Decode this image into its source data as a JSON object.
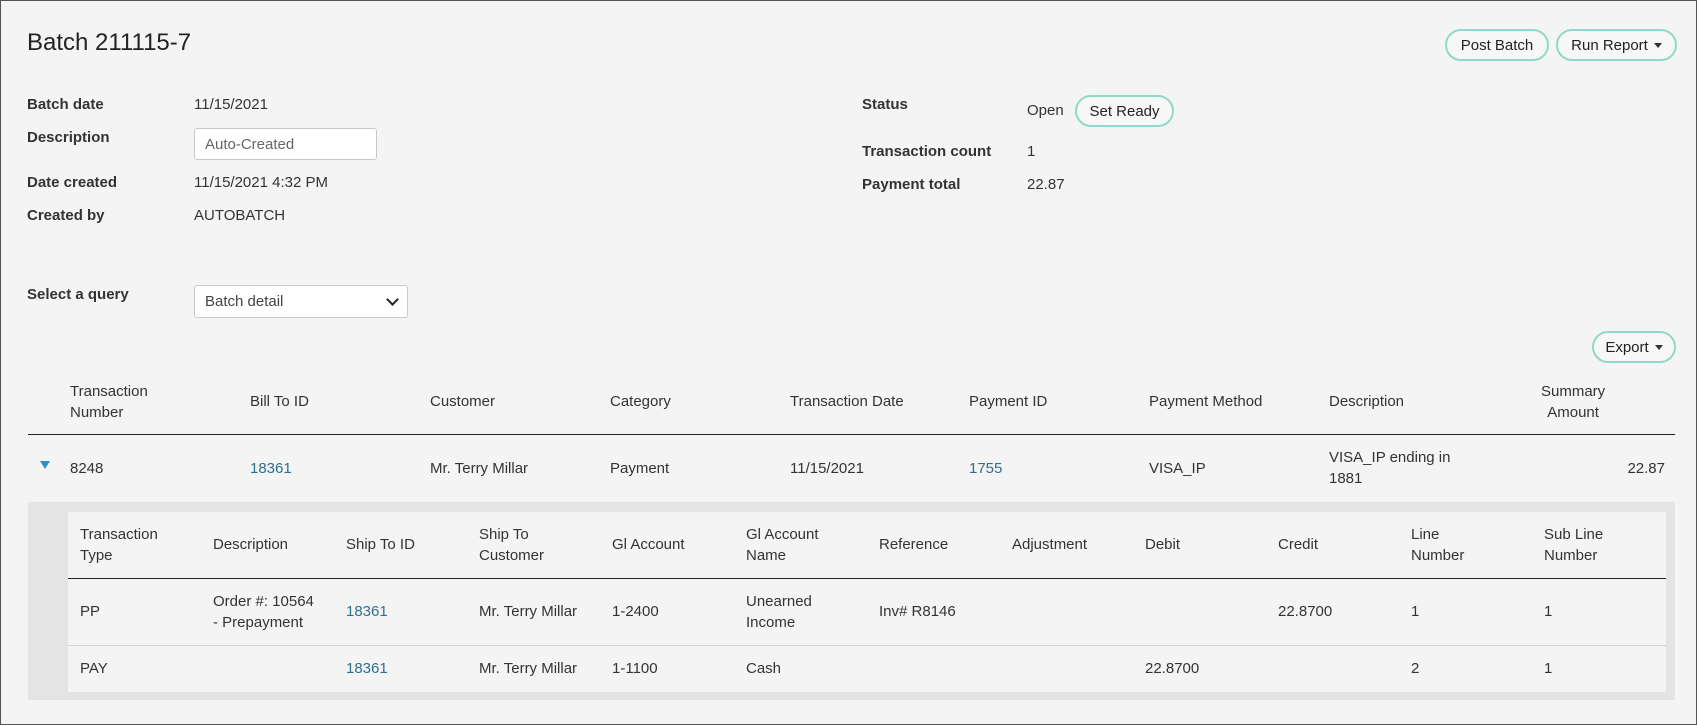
{
  "header": {
    "title": "Batch 211115-7",
    "post_batch_label": "Post Batch",
    "run_report_label": "Run Report"
  },
  "details": {
    "batch_date_label": "Batch date",
    "batch_date": "11/15/2021",
    "description_label": "Description",
    "description_value": "Auto-Created",
    "date_created_label": "Date created",
    "date_created": "11/15/2021 4:32 PM",
    "created_by_label": "Created by",
    "created_by": "AUTOBATCH",
    "status_label": "Status",
    "status": "Open",
    "set_ready_label": "Set Ready",
    "transaction_count_label": "Transaction count",
    "transaction_count": "1",
    "payment_total_label": "Payment total",
    "payment_total": "22.87"
  },
  "query": {
    "label": "Select a query",
    "selected": "Batch detail"
  },
  "export_label": "Export",
  "main_table": {
    "headers": {
      "transaction_number": [
        "Transaction",
        "Number"
      ],
      "bill_to_id": "Bill To ID",
      "customer": "Customer",
      "category": "Category",
      "transaction_date": "Transaction Date",
      "payment_id": "Payment ID",
      "payment_method": "Payment Method",
      "description": "Description",
      "summary_amount": [
        "Summary",
        "Amount"
      ]
    },
    "row": {
      "transaction_number": "8248",
      "bill_to_id": "18361",
      "customer": "Mr. Terry Millar",
      "category": "Payment",
      "transaction_date": "11/15/2021",
      "payment_id": "1755",
      "payment_method": "VISA_IP",
      "description": [
        "VISA_IP ending in",
        "1881"
      ],
      "summary_amount": "22.87"
    }
  },
  "sub_table": {
    "headers": {
      "transaction_type": [
        "Transaction",
        "Type"
      ],
      "description": "Description",
      "ship_to_id": "Ship To ID",
      "ship_to_customer": [
        "Ship To",
        "Customer"
      ],
      "gl_account": "Gl Account",
      "gl_account_name": [
        "Gl Account",
        "Name"
      ],
      "reference": "Reference",
      "adjustment": "Adjustment",
      "debit": "Debit",
      "credit": "Credit",
      "line_number": [
        "Line",
        "Number"
      ],
      "sub_line_number": [
        "Sub Line",
        "Number"
      ]
    },
    "rows": [
      {
        "transaction_type": "PP",
        "description": [
          "Order #: 10564",
          "- Prepayment"
        ],
        "ship_to_id": "18361",
        "ship_to_customer": "Mr. Terry Millar",
        "gl_account": "1-2400",
        "gl_account_name": [
          "Unearned",
          "Income"
        ],
        "reference": "Inv# R8146",
        "adjustment": "",
        "debit": "",
        "credit": "22.8700",
        "line_number": "1",
        "sub_line_number": "1"
      },
      {
        "transaction_type": "PAY",
        "description": "",
        "ship_to_id": "18361",
        "ship_to_customer": "Mr. Terry Millar",
        "gl_account": "1-1100",
        "gl_account_name": "Cash",
        "reference": "",
        "adjustment": "",
        "debit": "22.8700",
        "credit": "",
        "line_number": "2",
        "sub_line_number": "1"
      }
    ]
  }
}
